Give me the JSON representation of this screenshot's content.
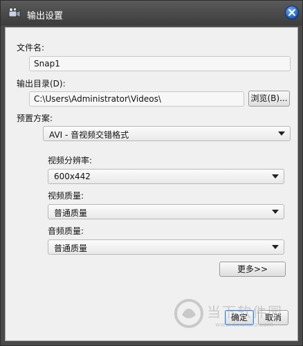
{
  "window": {
    "title": "输出设置"
  },
  "file_name": {
    "label": "文件名:",
    "value": "Snap1"
  },
  "output_dir": {
    "label": "输出目录(D):",
    "value": "C:\\Users\\Administrator\\Videos\\",
    "browse_label": "浏览(B)..."
  },
  "preset": {
    "label": "预置方案:",
    "selected": "AVI - 音视频交错格式"
  },
  "video_resolution": {
    "label": "视频分辨率:",
    "selected": "600x442"
  },
  "video_quality": {
    "label": "视频质量:",
    "selected": "普通质量"
  },
  "audio_quality": {
    "label": "音频质量:",
    "selected": "普通质量"
  },
  "buttons": {
    "more": "更多>>",
    "ok": "确定",
    "cancel": "取消"
  },
  "watermark": {
    "text": "当下软件园",
    "url": "www.downxia.com"
  },
  "icons": {
    "title_icon": "camcorder-icon",
    "close_icon": "close-icon",
    "dropdown_icon": "chevron-down-icon",
    "watermark_logo": "watermark-logo-icon"
  }
}
